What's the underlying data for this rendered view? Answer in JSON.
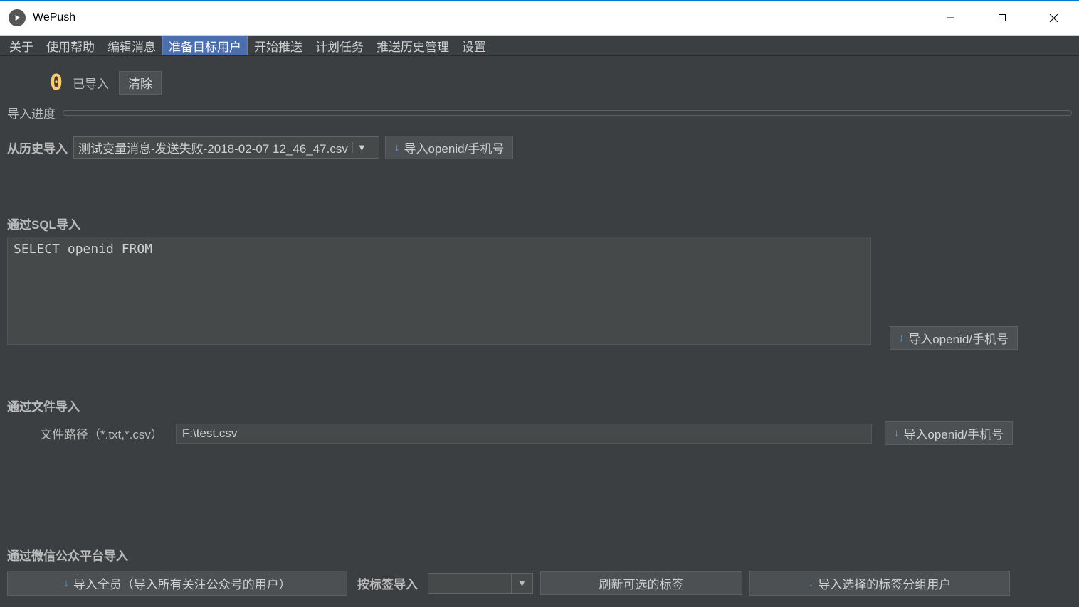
{
  "window": {
    "title": "WePush"
  },
  "tabs": {
    "about": "关于",
    "help": "使用帮助",
    "edit_msg": "编辑消息",
    "prepare_users": "准备目标用户",
    "start_push": "开始推送",
    "schedule": "计划任务",
    "history": "推送历史管理",
    "settings": "设置"
  },
  "import_header": {
    "count": "0",
    "label": "已导入",
    "clear_btn": "清除"
  },
  "progress": {
    "label": "导入进度"
  },
  "history_import": {
    "label": "从历史导入",
    "selected": "测试变量消息-发送失败-2018-02-07 12_46_47.csv",
    "btn": "导入openid/手机号"
  },
  "sql_import": {
    "title": "通过SQL导入",
    "value": "SELECT openid FROM",
    "btn": "导入openid/手机号"
  },
  "file_import": {
    "title": "通过文件导入",
    "label": "文件路径（*.txt,*.csv）",
    "value": "F:\\test.csv",
    "btn": "导入openid/手机号"
  },
  "wechat_import": {
    "title": "通过微信公众平台导入",
    "import_all": "导入全员（导入所有关注公众号的用户）",
    "tag_label": "按标签导入",
    "refresh_tags": "刷新可选的标签",
    "import_selected": "导入选择的标签分组用户"
  }
}
